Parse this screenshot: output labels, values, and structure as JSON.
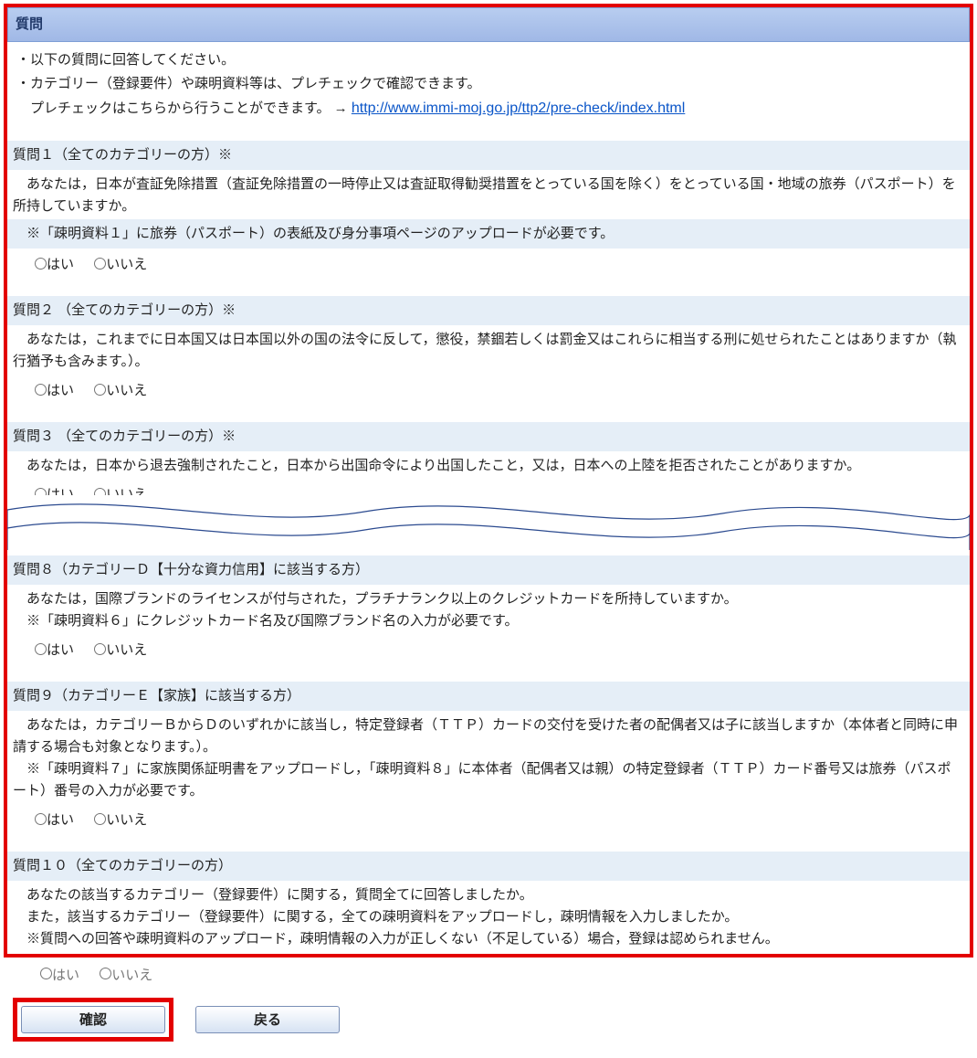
{
  "title": "質問",
  "intro": {
    "line1": "・以下の質問に回答してください。",
    "line2": "・カテゴリー（登録要件）や疎明資料等は、プレチェックで確認できます。",
    "line3_prefix": "　プレチェックはこちらから行うことができます。 → ",
    "precheck_url": "http://www.immi-moj.go.jp/ttp2/pre-check/index.html"
  },
  "option_yes": "はい",
  "option_no": "いいえ",
  "q1": {
    "title": "質問１（全てのカテゴリーの方）※",
    "body": "あなたは，日本が査証免除措置（査証免除措置の一時停止又は査証取得勧奨措置をとっている国を除く）をとっている国・地域の旅券（パスポート）を所持していますか。",
    "note": "※「疎明資料１」に旅券（パスポート）の表紙及び身分事項ページのアップロードが必要です。"
  },
  "q2": {
    "title": "質問２ （全てのカテゴリーの方）※",
    "body": "あなたは，これまでに日本国又は日本国以外の国の法令に反して，懲役，禁錮若しくは罰金又はこれらに相当する刑に処せられたことはありますか（執行猶予も含みます。）。"
  },
  "q3": {
    "title": "質問３ （全てのカテゴリーの方）※",
    "body": "あなたは，日本から退去強制されたこと，日本から出国命令により出国したこと，又は，日本への上陸を拒否されたことがありますか。"
  },
  "q8": {
    "title": "質問８（カテゴリーＤ【十分な資力信用】に該当する方）",
    "body": "あなたは，国際ブランドのライセンスが付与された，プラチナランク以上のクレジットカードを所持していますか。",
    "note": "※「疎明資料６」にクレジットカード名及び国際ブランド名の入力が必要です。"
  },
  "q9": {
    "title": "質問９（カテゴリーＥ【家族】に該当する方）",
    "body": "あなたは，カテゴリーＢからＤのいずれかに該当し，特定登録者（ＴＴＰ）カードの交付を受けた者の配偶者又は子に該当しますか（本体者と同時に申請する場合も対象となります。）。",
    "note": "※「疎明資料７」に家族関係証明書をアップロードし，「疎明資料８」に本体者（配偶者又は親）の特定登録者（ＴＴＰ）カード番号又は旅券（パスポート）番号の入力が必要です。"
  },
  "q10": {
    "title": "質問１０（全てのカテゴリーの方）",
    "body1": "あなたの該当するカテゴリー（登録要件）に関する，質問全てに回答しましたか。",
    "body2": "また，該当するカテゴリー（登録要件）に関する，全ての疎明資料をアップロードし，疎明情報を入力しましたか。",
    "body3": "※質問への回答や疎明資料のアップロード，疎明情報の入力が正しくない（不足している）場合，登録は認められません。"
  },
  "buttons": {
    "confirm": "確認",
    "back": "戻る"
  }
}
